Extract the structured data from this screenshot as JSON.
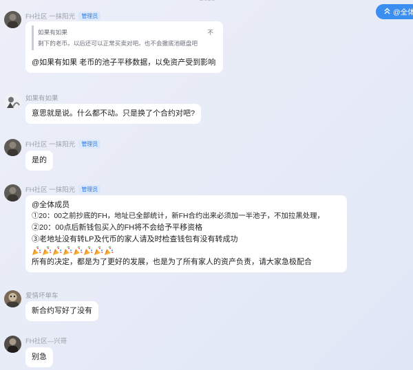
{
  "timestamp_partial": "2023",
  "top_button": {
    "label": "@全体",
    "icon": "double-chevron-up-icon",
    "color": "#3a8ef0"
  },
  "messages": [
    {
      "sender": "FH社区 一抹阳光",
      "badge": "管理员",
      "quote": {
        "author": "如果有如果",
        "tail": "不",
        "text": "剩下的老币。以后还可以正常买卖对吧。也不会撤底池砸盘吧"
      },
      "lines": [
        "@如果有如果 老币的池子平移数据，以免资产受到影响"
      ]
    },
    {
      "sender": "如果有如果",
      "badge": "",
      "lines": [
        "意思就是说。什么都不动。只是换了个合约对吧?"
      ]
    },
    {
      "sender": "FH社区 一抹阳光",
      "badge": "管理员",
      "lines": [
        "是的"
      ]
    },
    {
      "sender": "FH社区 一抹阳光",
      "badge": "管理员",
      "lines": [
        "@全体成员",
        "①20：00之前抄底的FH，地址已全部统计，新FH合约出来必须加一半池子，不加拉黑处理，",
        "②20：00点后新钱包买入的FH将不会给予平移资格",
        "③老地址没有转LP及代币的家人请及时检查钱包有没有转成功",
        "所有的决定，都是为了更好的发展，也是为了所有家人的资产负责，请大家急极配合"
      ],
      "emoji": "party-popper-icon",
      "emoji_count": 8
    },
    {
      "sender": "爱情坏单车",
      "badge": "",
      "lines": [
        "新合约写好了没有"
      ]
    },
    {
      "sender": "FH社区—兴哥",
      "badge": "",
      "lines": [
        "别急"
      ]
    }
  ]
}
